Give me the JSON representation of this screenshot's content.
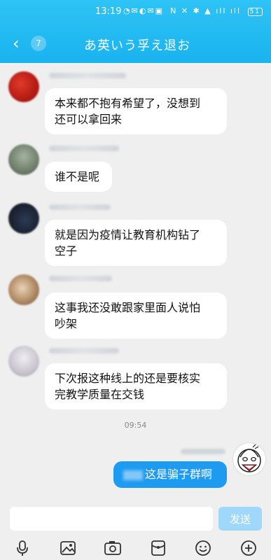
{
  "status_bar": {
    "time": "13:19",
    "left_icons": "◔✉◐✉▣",
    "right_icons": "N ✕ ✱ ▲ ıll ıll",
    "battery": "51"
  },
  "header": {
    "unread_count": "7",
    "title": "あ英いう孚え退お"
  },
  "messages": [
    {
      "text": "本来都不抱有希望了，没想到\n还可以拿回来"
    },
    {
      "text": "谁不是呢"
    },
    {
      "text": "就是因为疫情让教育机构钻了\n空子"
    },
    {
      "text": "这事我还没敢跟家里面人说怕\n吵架"
    },
    {
      "text": "下次报这种线上的还是要核实\n完教学质量在交钱"
    }
  ],
  "timestamp": "09:54",
  "my_message": {
    "text": "这是骗子群啊"
  },
  "input": {
    "placeholder": "",
    "send_label": "发送"
  },
  "colors": {
    "header": "#1ab3ef",
    "my_bubble": "#1d9bf0",
    "send_button": "#9fd8fb"
  },
  "toolbar_icons": [
    "microphone-icon",
    "image-icon",
    "camera-icon",
    "red-packet-icon",
    "emoji-icon",
    "plus-icon"
  ]
}
